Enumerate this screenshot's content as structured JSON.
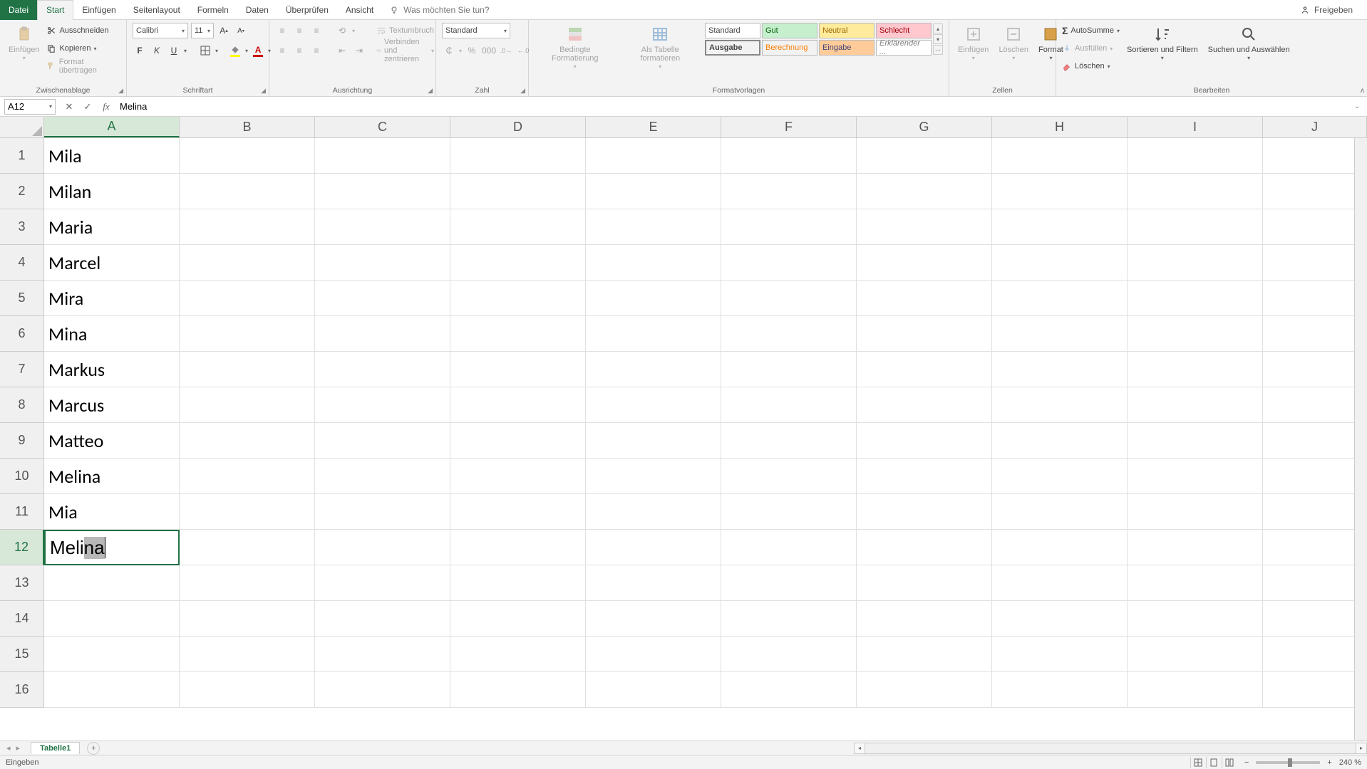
{
  "tabs": {
    "file": "Datei",
    "start": "Start",
    "insert": "Einfügen",
    "pagelayout": "Seitenlayout",
    "formulas": "Formeln",
    "data": "Daten",
    "review": "Überprüfen",
    "view": "Ansicht",
    "tellme": "Was möchten Sie tun?"
  },
  "titlebar": {
    "share": "Freigeben"
  },
  "ribbon": {
    "clipboard": {
      "label": "Zwischenablage",
      "paste": "Einfügen",
      "cut": "Ausschneiden",
      "copy": "Kopieren",
      "format_painter": "Format übertragen"
    },
    "font": {
      "label": "Schriftart",
      "name": "Calibri",
      "size": "11",
      "bold": "F",
      "italic": "K",
      "underline": "U"
    },
    "alignment": {
      "label": "Ausrichtung",
      "wrap": "Textumbruch",
      "merge": "Verbinden und zentrieren"
    },
    "number": {
      "label": "Zahl",
      "format": "Standard"
    },
    "styles": {
      "label": "Formatvorlagen",
      "conditional": "Bedingte Formatierung",
      "as_table": "Als Tabelle formatieren",
      "s_standard": "Standard",
      "s_gut": "Gut",
      "s_neutral": "Neutral",
      "s_schlecht": "Schlecht",
      "s_ausgabe": "Ausgabe",
      "s_berechnung": "Berechnung",
      "s_eingabe": "Eingabe",
      "s_erklarender": "Erklärender ..."
    },
    "cells": {
      "label": "Zellen",
      "insert": "Einfügen",
      "delete": "Löschen",
      "format": "Format"
    },
    "editing": {
      "label": "Bearbeiten",
      "autosum": "AutoSumme",
      "fill": "Ausfüllen",
      "clear": "Löschen",
      "sort": "Sortieren und Filtern",
      "find": "Suchen und Auswählen"
    }
  },
  "formula_bar": {
    "name_box": "A12",
    "value": "Melina"
  },
  "columns": [
    "A",
    "B",
    "C",
    "D",
    "E",
    "F",
    "G",
    "H",
    "I",
    "J"
  ],
  "rows": [
    "1",
    "2",
    "3",
    "4",
    "5",
    "6",
    "7",
    "8",
    "9",
    "10",
    "11",
    "12",
    "13",
    "14",
    "15",
    "16"
  ],
  "data": {
    "A1": "Mila",
    "A2": "Milan",
    "A3": "Maria",
    "A4": "Marcel",
    "A5": "Mira",
    "A6": "Mina",
    "A7": "Markus",
    "A8": "Marcus",
    "A9": "Matteo",
    "A10": "Melina",
    "A11": "Mia",
    "A12_typed": "Meli",
    "A12_auto": "na"
  },
  "active_cell": "A12",
  "sheet": {
    "tab1": "Tabelle1"
  },
  "status": {
    "mode": "Eingeben",
    "zoom": "240 %"
  }
}
